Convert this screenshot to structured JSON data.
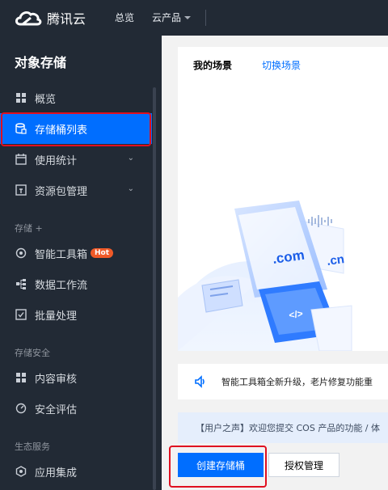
{
  "colors": {
    "topbar": "#222a35",
    "accent": "#006eff",
    "hot_badge": "#f05a28",
    "highlight": "#e01020"
  },
  "topbar": {
    "brand": "腾讯云",
    "nav_overview": "总览",
    "nav_products": "云产品",
    "nav_products_icon": "caret-down-icon"
  },
  "sidebar": {
    "title": "对象存储",
    "items": [
      {
        "label": "概览",
        "icon": "grid-icon"
      },
      {
        "label": "存储桶列表",
        "icon": "bucket-icon"
      },
      {
        "label": "使用统计",
        "icon": "calendar-icon",
        "chevron": "⌄"
      },
      {
        "label": "资源包管理",
        "icon": "package-icon",
        "chevron": "⌄"
      }
    ],
    "section_storage_plus": "存储 +",
    "storage_plus_items": [
      {
        "label": "智能工具箱",
        "icon": "toolbox-icon",
        "badge": "Hot"
      },
      {
        "label": "数据工作流",
        "icon": "workflow-icon"
      },
      {
        "label": "批量处理",
        "icon": "checkbox-icon"
      }
    ],
    "section_security": "存储安全",
    "security_items": [
      {
        "label": "内容审核",
        "icon": "grid-icon"
      },
      {
        "label": "安全评估",
        "icon": "gauge-icon"
      }
    ],
    "section_ecosystem": "生态服务",
    "ecosystem_items": [
      {
        "label": "应用集成",
        "icon": "hexagon-icon"
      }
    ]
  },
  "main": {
    "scene_title": "我的场景",
    "scene_switch": "切换场景",
    "illustration": {
      "label_com": ".com",
      "label_cn": ".cn",
      "label_code": "</>"
    },
    "notice": "智能工具箱全新升级，老片修复功能重",
    "voice": "【用户之声】欢迎您提交 COS 产品的功能 / 体",
    "create_bucket": "创建存储桶",
    "auth_manage": "授权管理"
  }
}
